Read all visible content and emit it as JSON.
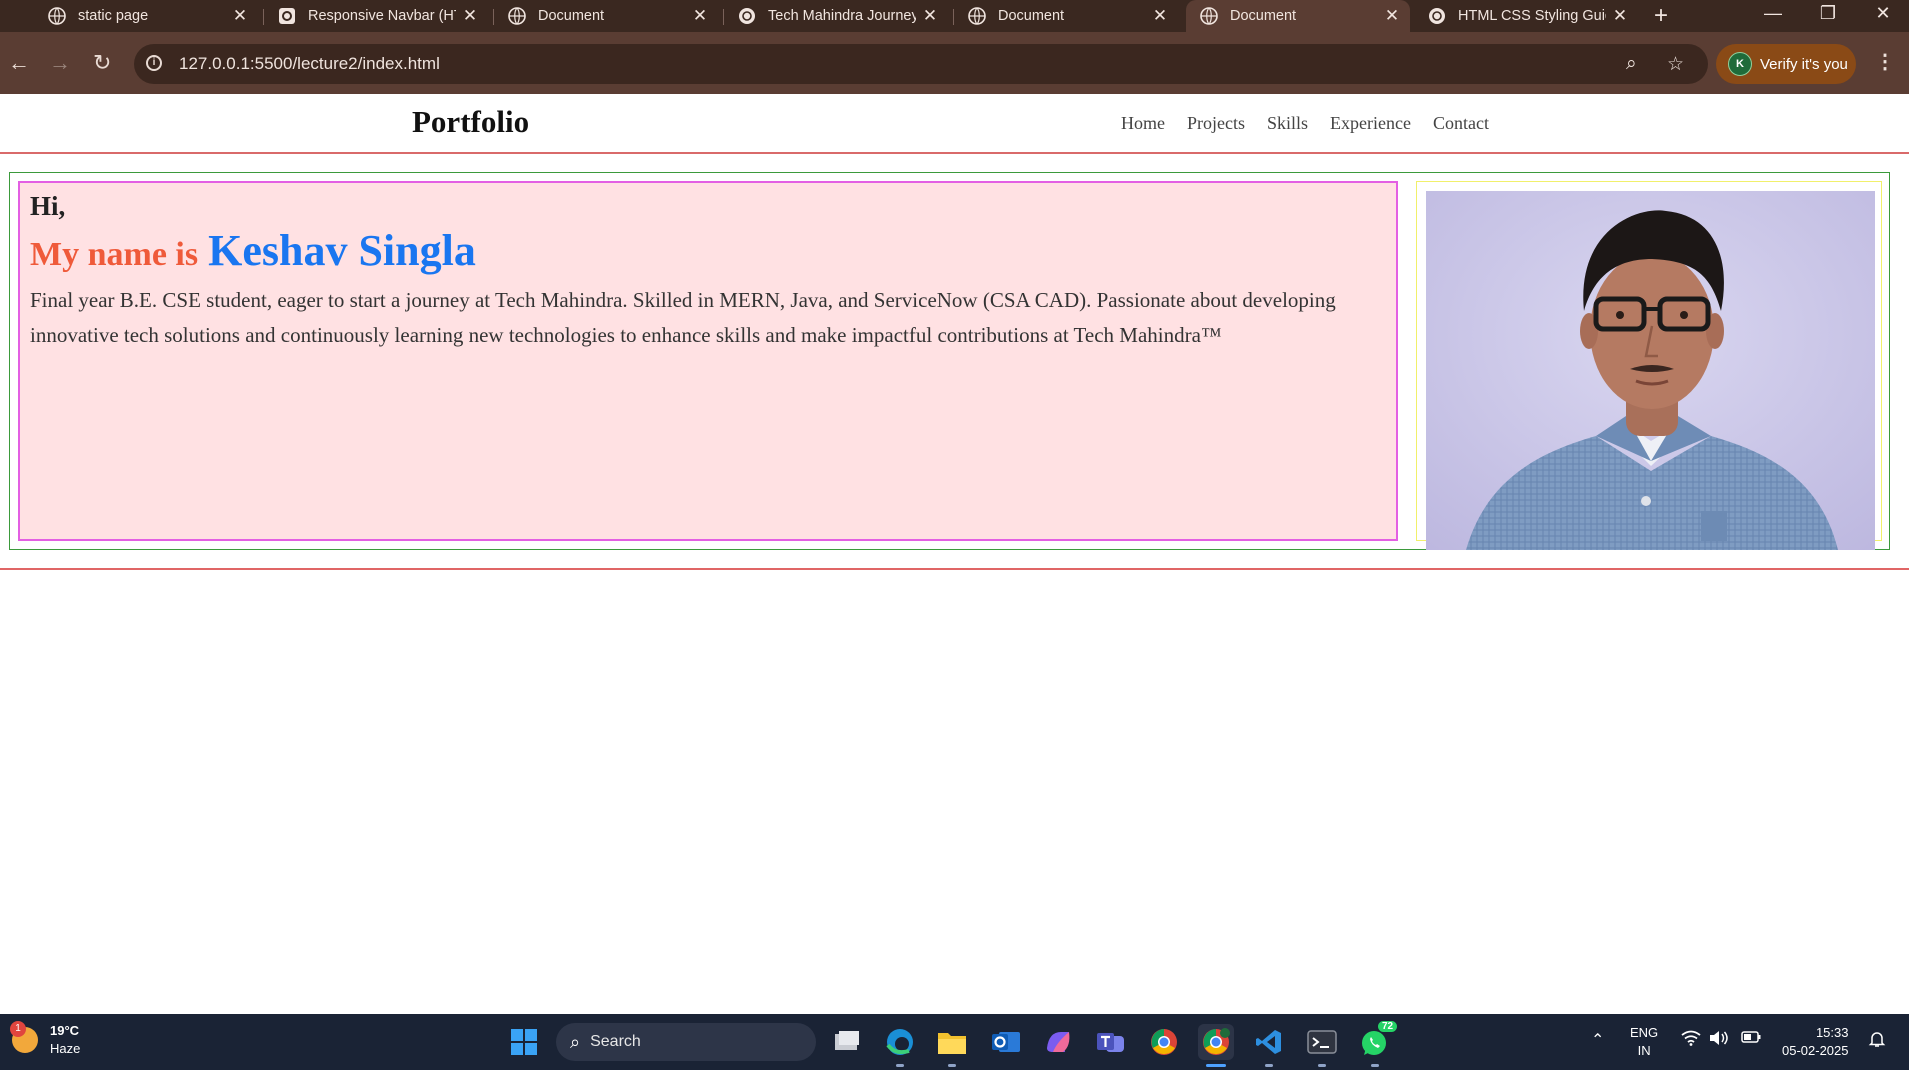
{
  "browser": {
    "tabs": [
      {
        "title": "static page",
        "active": false
      },
      {
        "title": "Responsive Navbar (HT",
        "active": false
      },
      {
        "title": "Document",
        "active": false
      },
      {
        "title": "Tech Mahindra Journey",
        "active": false
      },
      {
        "title": "Document",
        "active": false
      },
      {
        "title": "Document",
        "active": true
      },
      {
        "title": "HTML CSS Styling Guid",
        "active": false
      }
    ],
    "new_tab_glyph": "+",
    "window_controls": {
      "minimize": "—",
      "restore": "❐",
      "close": "✕"
    },
    "url": "127.0.0.1:5500/lecture2/index.html",
    "verify_label": "Verify it's you",
    "profile_initial": "K",
    "accent_color": "#8a4a16"
  },
  "site": {
    "brand": "Portfolio",
    "nav": [
      "Home",
      "Projects",
      "Skills",
      "Experience",
      "Contact"
    ],
    "hero": {
      "greeting": "Hi,",
      "name_prefix": "My name is",
      "name": "Keshav Singla",
      "bio": "Final year B.E. CSE student, eager to start a journey at Tech Mahindra. Skilled in MERN, Java, and ServiceNow (CSA CAD). Passionate about developing innovative tech solutions and continuously learning new technologies to enhance skills and make impactful contributions at Tech Mahindra™"
    },
    "colors": {
      "name_prefix": "#ef5a3a",
      "name": "#1a76f0",
      "hero_bg": "#ffe1e3",
      "nav_border": "#d96a6a"
    }
  },
  "taskbar": {
    "weather": {
      "temp": "19°C",
      "condition": "Haze",
      "badge": "1"
    },
    "search_label": "Search",
    "whatsapp_badge": "72",
    "lang": {
      "line1": "ENG",
      "line2": "IN"
    },
    "time": "15:33",
    "date": "05-02-2025"
  }
}
